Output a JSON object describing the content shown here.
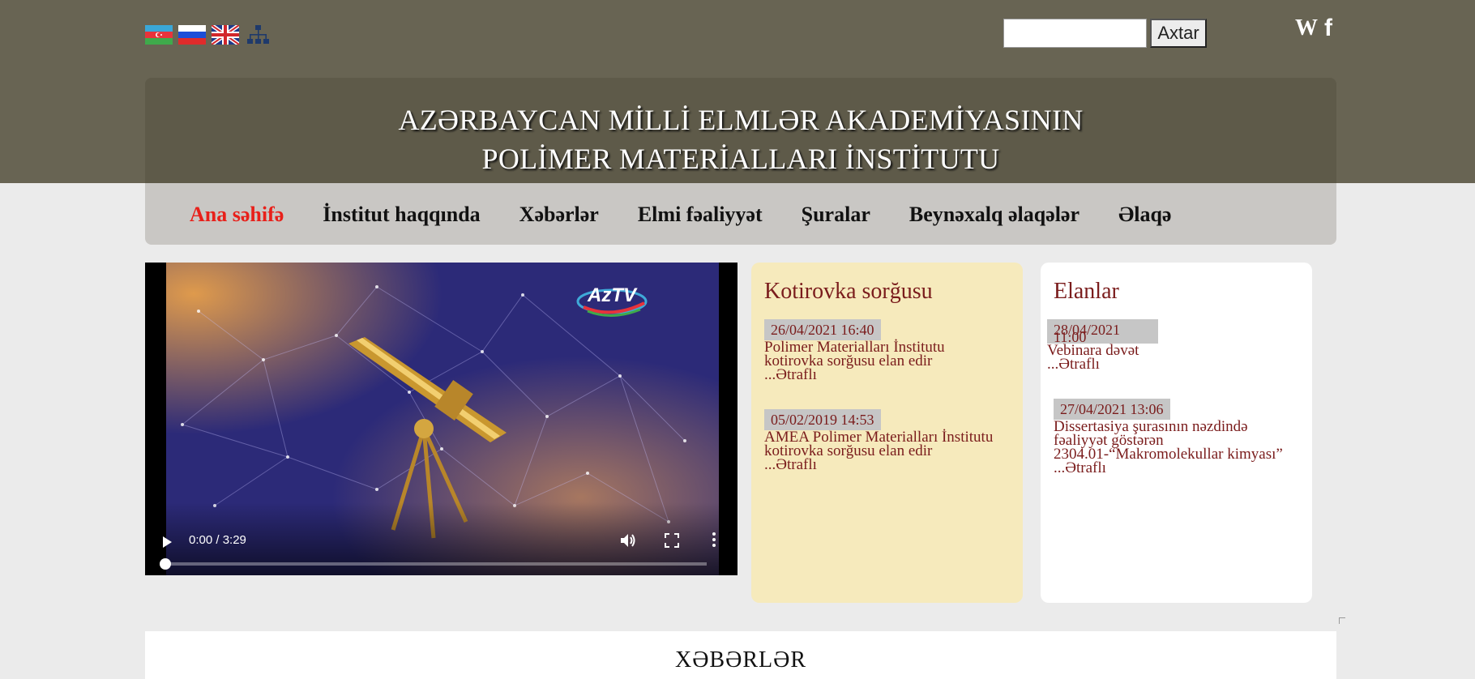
{
  "header": {
    "title_line1": "AZƏRBAYCAN MİLLİ ELMLƏR AKADEMİYASININ",
    "title_line2": "POLİMER MATERİALLARI İNSTİTUTU"
  },
  "languages": [
    {
      "code": "az",
      "icon": "flag-azerbaijan-icon"
    },
    {
      "code": "ru",
      "icon": "flag-russia-icon"
    },
    {
      "code": "en",
      "icon": "flag-uk-icon"
    }
  ],
  "search": {
    "placeholder": "",
    "value": "",
    "button_label": "Axtar"
  },
  "social": {
    "wiki_label": "W",
    "facebook_label": "f"
  },
  "nav": {
    "items": [
      {
        "label": "Ana səhifə",
        "active": true
      },
      {
        "label": "İnstitut haqqında",
        "active": false
      },
      {
        "label": "Xəbərlər",
        "active": false
      },
      {
        "label": "Elmi fəaliyyət",
        "active": false
      },
      {
        "label": "Şuralar",
        "active": false
      },
      {
        "label": "Beynəxalq əlaqələr",
        "active": false
      },
      {
        "label": "Əlaqə",
        "active": false
      }
    ]
  },
  "video": {
    "time": "0:00 / 3:29",
    "progress": 0,
    "logo_text": "AzTV"
  },
  "kotirovka": {
    "title": "Kotirovka sorğusu",
    "entries": [
      {
        "date": "26/04/2021 16:40",
        "text": "Polimer Materialları İnstitutu kotirovka sorğusu elan edir",
        "more": "...Ətraflı"
      },
      {
        "date": "05/02/2019 14:53",
        "text": "AMEA Polimer Materialları İnstitutu kotirovka sorğusu elan edir",
        "more": "...Ətraflı"
      }
    ]
  },
  "elanlar": {
    "title": "Elanlar",
    "entries": [
      {
        "date": "28/04/2021",
        "time": "11:00",
        "text": "Vebinara dəvət",
        "more": "...Ətraflı"
      },
      {
        "date": "27/04/2021 13:06",
        "text": "Dissertasiya şurasının nəzdində fəaliyyət göstərən 2304.01-“Makromolekullar kimyası”",
        "more": "...Ətraflı"
      }
    ]
  },
  "news": {
    "title": "XƏBƏRLƏR"
  },
  "colors": {
    "top_band": "#686453",
    "header_box": "#5e5a49",
    "nav_bar": "#c9c7c4",
    "active_nav": "#e8201a",
    "link_maroon": "#7a1c1c",
    "kotirovka_bg": "#f6eabc"
  }
}
